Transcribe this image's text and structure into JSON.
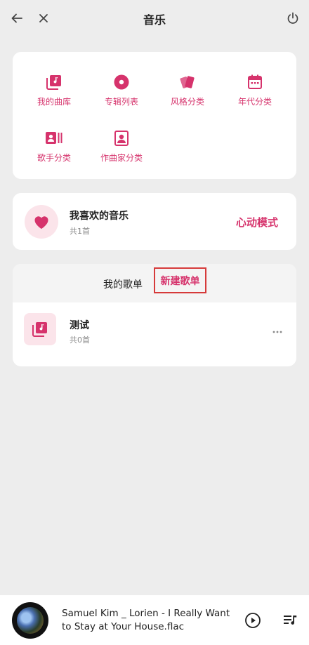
{
  "header": {
    "title": "音乐",
    "back_icon": "arrow-left-icon",
    "close_icon": "close-icon",
    "power_icon": "power-icon"
  },
  "categories": [
    {
      "label": "我的曲库",
      "icon": "music-library-icon"
    },
    {
      "label": "专辑列表",
      "icon": "album-disc-icon"
    },
    {
      "label": "风格分类",
      "icon": "style-cards-icon"
    },
    {
      "label": "年代分类",
      "icon": "calendar-icon"
    },
    {
      "label": "歌手分类",
      "icon": "artist-card-icon"
    },
    {
      "label": "作曲家分类",
      "icon": "composer-portrait-icon"
    }
  ],
  "favorites": {
    "title": "我喜欢的音乐",
    "count": "共1首",
    "mode": "心动模式",
    "icon": "heart-icon"
  },
  "playlists": {
    "tab_mine": "我的歌单",
    "tab_new": "新建歌单",
    "items": [
      {
        "name": "测试",
        "count": "共0首",
        "icon": "music-note-icon"
      }
    ]
  },
  "player": {
    "track": "Samuel Kim _ Lorien - I Really Want to Stay at Your House.flac",
    "play_icon": "play-circle-icon",
    "queue_icon": "playlist-queue-icon"
  },
  "colors": {
    "accent": "#d6336c",
    "accent_light": "#fbe4ea",
    "background": "#ededed",
    "highlight_box": "#d63a3a"
  }
}
